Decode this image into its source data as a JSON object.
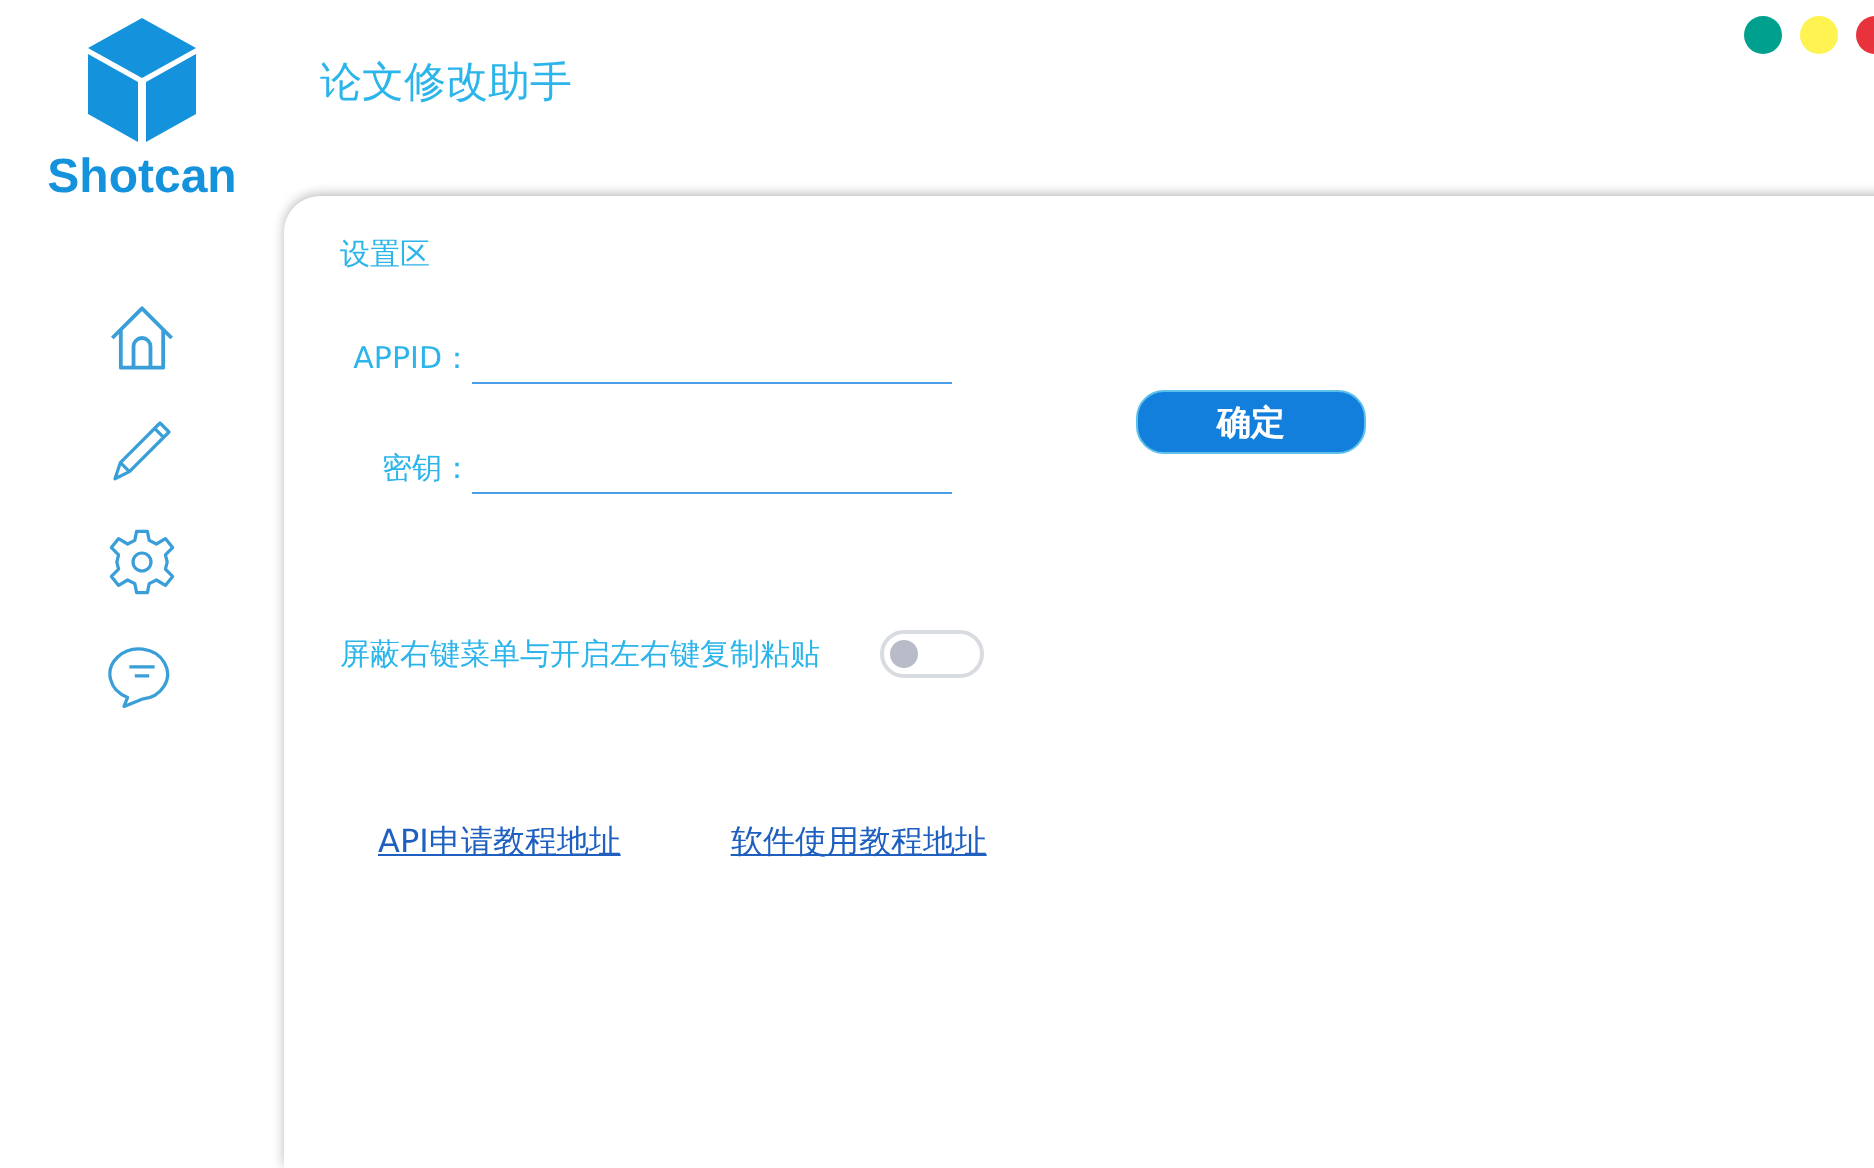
{
  "app": {
    "logo_text": "Shotcan",
    "title": "论文修改助手"
  },
  "window_controls": [
    {
      "color": "#00a08e"
    },
    {
      "color": "#fef350"
    },
    {
      "color": "#e8333c"
    }
  ],
  "panel": {
    "section_title": "设置区",
    "fields": [
      {
        "label": "APPID："
      },
      {
        "label": "密钥："
      }
    ],
    "confirm_button": "确定",
    "toggle": {
      "label": "屏蔽右键菜单与开启左右键复制粘贴",
      "on": false
    },
    "links": [
      "API申请教程地址",
      "软件使用教程地址"
    ]
  }
}
